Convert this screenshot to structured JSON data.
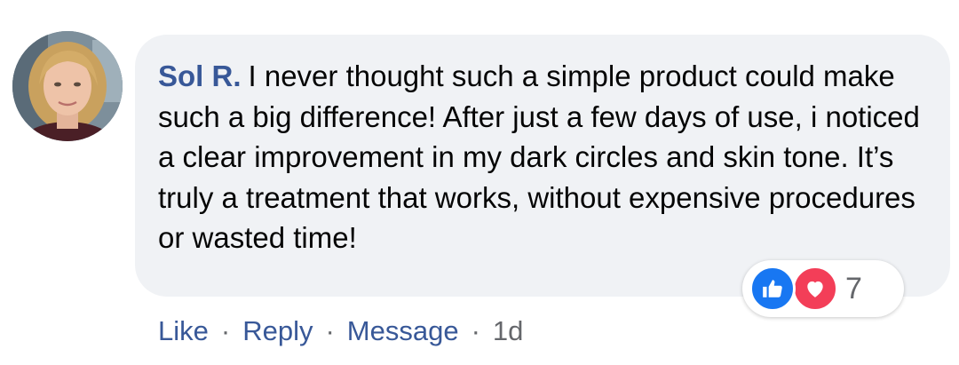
{
  "comment": {
    "author": "Sol R.",
    "text": "I never thought such a simple product could make such a big difference! After just a few days of use, i noticed a clear improvement in my dark circles and skin tone. It’s truly a treatment that works, without expensive procedures or wasted time!"
  },
  "reactions": {
    "icons": [
      "like-icon",
      "love-icon"
    ],
    "count": "7",
    "like_color": "#1877f2",
    "love_color": "#f33e58"
  },
  "actions": {
    "like_label": "Like",
    "reply_label": "Reply",
    "message_label": "Message",
    "separator": "·",
    "timestamp": "1d"
  },
  "colors": {
    "link": "#385898",
    "bubble": "#f0f2f5",
    "text": "#050505",
    "muted": "#65676b"
  }
}
